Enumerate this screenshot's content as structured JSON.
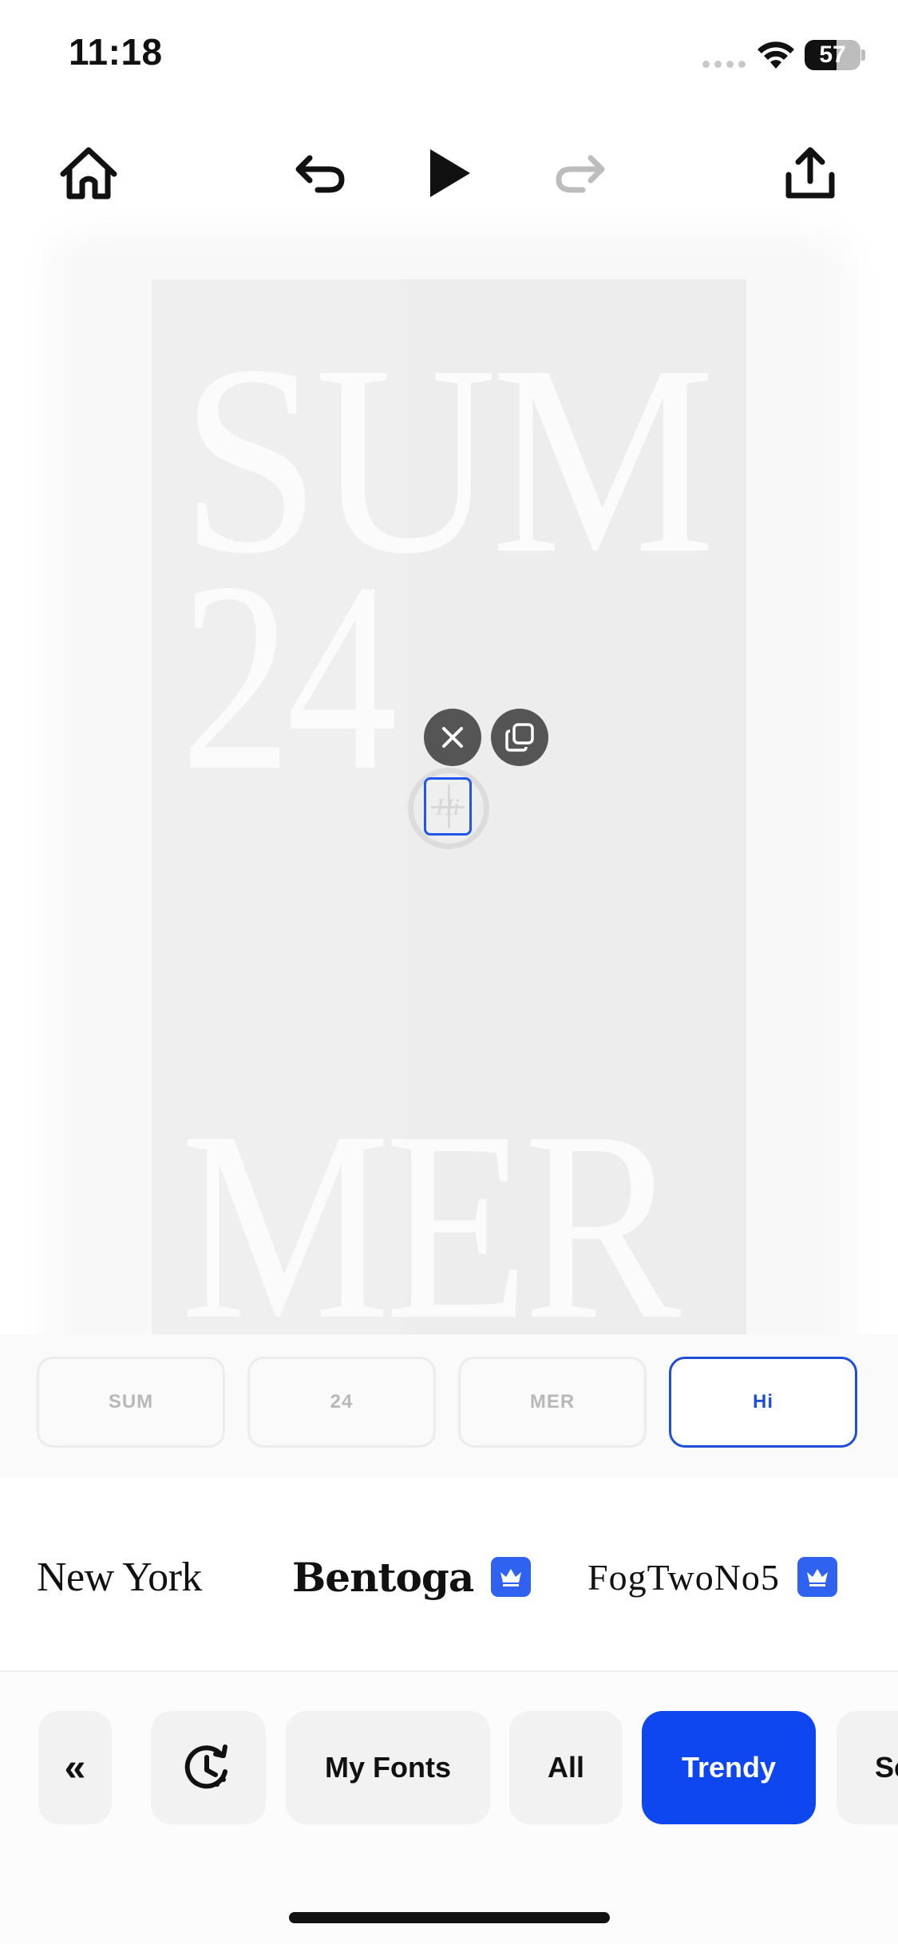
{
  "status_bar": {
    "time": "11:18",
    "battery": "57",
    "battery_level": 0.57
  },
  "toolbar": {
    "home": "home-icon",
    "undo": "undo-icon",
    "play": "play-icon",
    "redo": "redo-icon",
    "export": "share-icon"
  },
  "canvas": {
    "lines": [
      "SUM",
      "24",
      "MER"
    ],
    "selected_text": "Hi",
    "actions": {
      "delete": "close-icon",
      "duplicate": "duplicate-icon"
    }
  },
  "layers": [
    {
      "label": "SUM",
      "active": false
    },
    {
      "label": "24",
      "active": false
    },
    {
      "label": "MER",
      "active": false
    },
    {
      "label": "Hi",
      "active": true
    }
  ],
  "fonts": [
    {
      "name": "New York",
      "premium": false
    },
    {
      "name": "Bentoga",
      "premium": true
    },
    {
      "name": "FogTwoNo5",
      "premium": true
    }
  ],
  "categories": {
    "collapse": "«",
    "recent": "history-icon",
    "tabs": [
      "My Fonts",
      "All",
      "Trendy",
      "Se"
    ],
    "active": "Trendy"
  },
  "colors": {
    "accent": "#0e47f0",
    "selection": "#2057e8",
    "crown": "#2f62f0"
  }
}
